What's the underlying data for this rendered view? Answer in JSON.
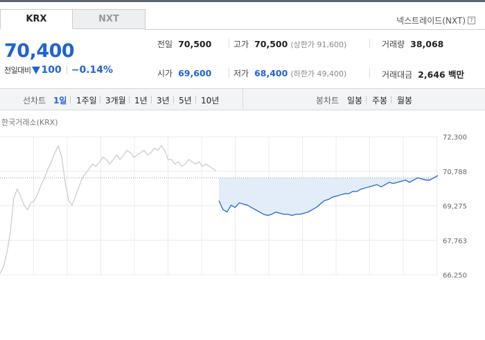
{
  "tabs": [
    {
      "label": "KRX",
      "active": true
    },
    {
      "label": "NXT",
      "active": false
    }
  ],
  "nxt_link": "넥스트레이드(NXT)",
  "price": "70,400",
  "change": {
    "label": "전일대비",
    "direction": "down",
    "amount": "100",
    "rate": "−0.14%"
  },
  "stats": {
    "prev_close": {
      "label": "전일",
      "value": "70,500"
    },
    "high": {
      "label": "고가",
      "value": "70,500",
      "sub": "(상한가 91,600)"
    },
    "volume": {
      "label": "거래량",
      "value": "38,068"
    },
    "open": {
      "label": "시가",
      "value": "69,600"
    },
    "low": {
      "label": "저가",
      "value": "68,400",
      "sub": "(하한가 49,400)"
    },
    "amount": {
      "label": "거래대금",
      "value": "2,646 백만"
    }
  },
  "toolbar": {
    "line_head": "선차트",
    "line_periods": [
      "1일",
      "1주일",
      "3개월",
      "1년",
      "3년",
      "5년",
      "10년"
    ],
    "active_period": "1일",
    "candle_head": "봉차트",
    "candle_periods": [
      "일봉",
      "주봉",
      "월봉"
    ]
  },
  "chart_source": "한국거래소(KRX)",
  "colors": {
    "accent": "#1f63d6",
    "series_today": "#2e6fd8",
    "series_prev": "#c9c9c9",
    "fill_today": "#e3edfa"
  },
  "chart_data": {
    "type": "line",
    "y_ticks": [
      "72,300",
      "70,788",
      "69,275",
      "67,763",
      "66,250"
    ],
    "ylim": [
      66250,
      72300
    ],
    "reference_line": 70500,
    "grid": true,
    "series": [
      {
        "values": [
          66300,
          66600,
          67200,
          68100,
          69600,
          70000,
          69700,
          69300,
          69100,
          69400,
          69500,
          69800,
          70200,
          70500,
          70900,
          71200,
          71600,
          71900,
          71400,
          70300,
          69500,
          69300,
          69700,
          70100,
          70500,
          70700,
          70900,
          71100,
          71000,
          71200,
          71400,
          71300,
          71100,
          71300,
          71500,
          71300,
          71500,
          71700,
          71600,
          71400,
          71500,
          71600,
          71700,
          71500,
          71600,
          71800,
          71700,
          71900,
          71700,
          71300,
          71300,
          71100,
          71200,
          71000,
          71100,
          71300,
          71200,
          71100,
          71200,
          71000,
          71100,
          71000,
          70900,
          70800
        ]
      },
      {
        "values": [
          69500,
          69100,
          69000,
          69300,
          69200,
          69400,
          69350,
          69300,
          69200,
          69100,
          69000,
          68900,
          68850,
          68900,
          69000,
          68950,
          68900,
          68900,
          68850,
          68900,
          68900,
          68950,
          69000,
          69100,
          69200,
          69350,
          69500,
          69550,
          69650,
          69700,
          69750,
          69800,
          69800,
          69900,
          69900,
          70000,
          70050,
          70100,
          70150,
          70200,
          70100,
          70200,
          70300,
          70250,
          70300,
          70350,
          70400,
          70300,
          70400,
          70500,
          70450,
          70400,
          70400,
          70500,
          70600
        ]
      }
    ]
  }
}
